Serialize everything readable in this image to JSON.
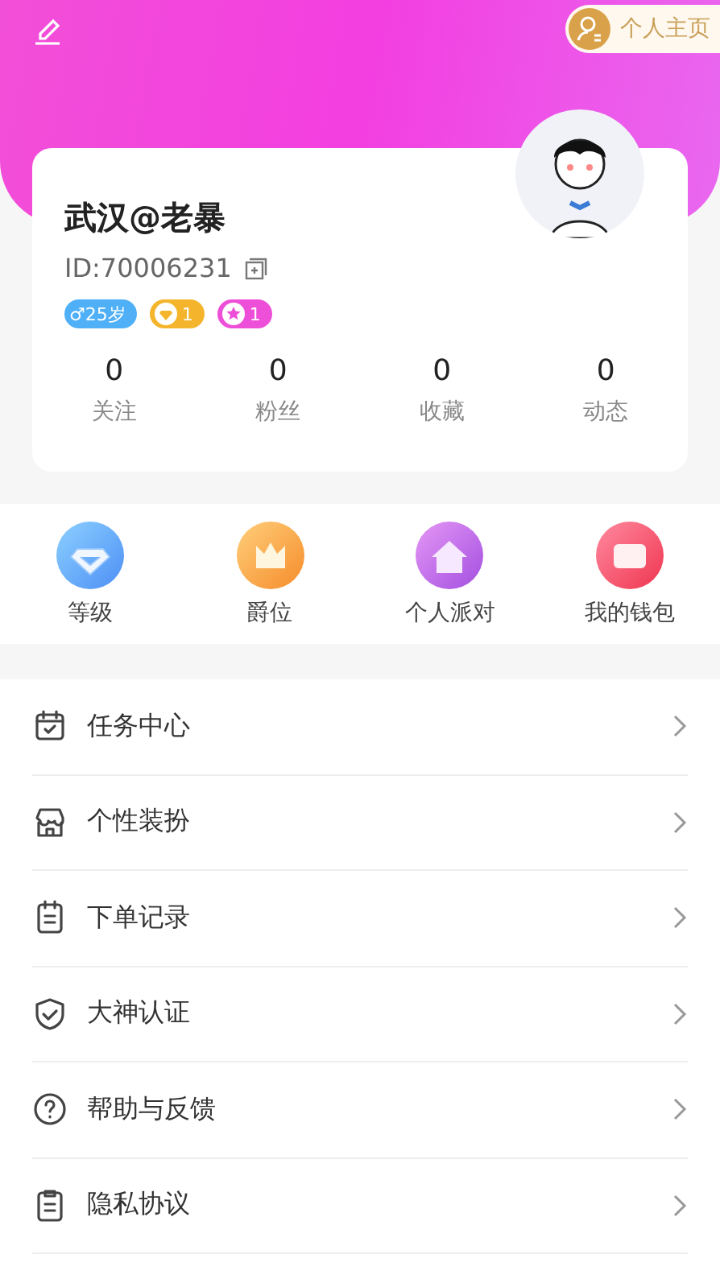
{
  "top_bar": {
    "homepage_button": "个人主页"
  },
  "profile": {
    "name": "武汉@老暴",
    "id": "ID:70006231",
    "badges": [
      {
        "kind": "age",
        "text": "♂25岁"
      },
      {
        "kind": "gem",
        "text": "1"
      },
      {
        "kind": "star",
        "text": "1"
      }
    ],
    "stats": [
      {
        "value": "0",
        "label": "关注"
      },
      {
        "value": "0",
        "label": "粉丝"
      },
      {
        "value": "0",
        "label": "收藏"
      },
      {
        "value": "0",
        "label": "动态"
      }
    ]
  },
  "shortcuts": [
    {
      "kind": "level",
      "label": "等级"
    },
    {
      "kind": "rank",
      "label": "爵位"
    },
    {
      "kind": "party",
      "label": "个人派对"
    },
    {
      "kind": "wallet",
      "label": "我的钱包"
    }
  ],
  "menu": [
    {
      "kind": "tasks",
      "label": "任务中心"
    },
    {
      "kind": "store",
      "label": "个性装扮"
    },
    {
      "kind": "orders",
      "label": "下单记录"
    },
    {
      "kind": "verify",
      "label": "大神认证"
    },
    {
      "kind": "help",
      "label": "帮助与反馈"
    },
    {
      "kind": "privacy",
      "label": "隐私协议"
    }
  ]
}
